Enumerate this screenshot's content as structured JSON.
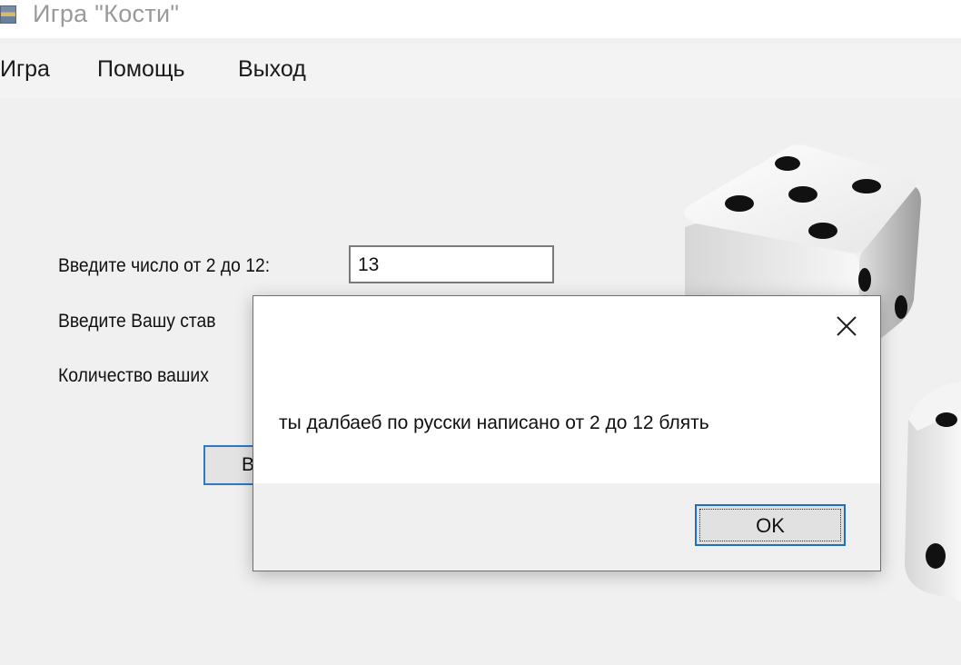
{
  "window": {
    "title": "Игра \"Кости\""
  },
  "menu": [
    {
      "label": "Игра"
    },
    {
      "label": "Помощь"
    },
    {
      "label": "Выход"
    }
  ],
  "form": {
    "number_label": "Введите число от 2 до 12:",
    "number_value": "13",
    "bet_label": "Введите Вашу став",
    "count_label": "Количество ваших",
    "button_label": "В"
  },
  "dialog": {
    "message": "ты далбаеб по русски написано от 2 до 12 блять",
    "ok_label": "OK"
  },
  "colors": {
    "accent": "#1f6fbf"
  },
  "icons": [
    "app-icon",
    "close-icon",
    "dice-icon"
  ]
}
